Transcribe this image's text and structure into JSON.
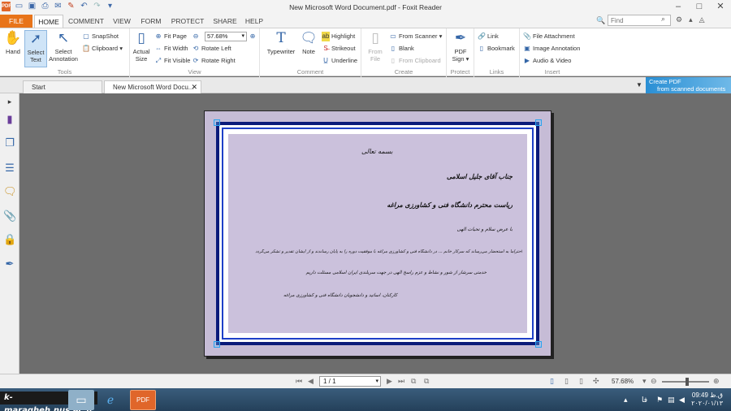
{
  "window": {
    "title": "New Microsoft Word Document.pdf - Foxit Reader",
    "logo": "PDF",
    "controls": [
      "–",
      "□",
      "✕"
    ]
  },
  "ribbon_tabs": [
    {
      "label": "FILE"
    },
    {
      "label": "HOME"
    },
    {
      "label": "COMMENT"
    },
    {
      "label": "VIEW"
    },
    {
      "label": "FORM"
    },
    {
      "label": "PROTECT"
    },
    {
      "label": "SHARE"
    },
    {
      "label": "HELP"
    }
  ],
  "search": {
    "placeholder": "Find"
  },
  "groups": {
    "tools": {
      "label": "Tools",
      "hand": "Hand",
      "select_text": "Select\nText",
      "select_annotation": "Select\nAnnotation",
      "snapshot": "SnapShot",
      "clipboard": "Clipboard"
    },
    "view": {
      "label": "View",
      "actual_size": "Actual\nSize",
      "fit_page": "Fit Page",
      "fit_width": "Fit Width",
      "fit_visible": "Fit Visible",
      "zoom_value": "57.68%",
      "rotate_left": "Rotate Left",
      "rotate_right": "Rotate Right"
    },
    "comment": {
      "label": "Comment",
      "typewriter": "Typewriter",
      "note": "Note",
      "highlight": "Highlight",
      "strikeout": "Strikeout",
      "underline": "Underline"
    },
    "create": {
      "label": "Create",
      "from_file": "From\nFile",
      "from_scanner": "From Scanner",
      "blank": "Blank",
      "from_clipboard": "From Clipboard"
    },
    "protect": {
      "label": "Protect",
      "pdf_sign": "PDF\nSign"
    },
    "links": {
      "label": "Links",
      "link": "Link",
      "bookmark": "Bookmark"
    },
    "insert": {
      "label": "Insert",
      "file_attachment": "File Attachment",
      "image_annotation": "Image Annotation",
      "audio_video": "Audio & Video"
    }
  },
  "doc_tabs": [
    {
      "label": "Start"
    },
    {
      "label": "New Microsoft Word Docu..."
    }
  ],
  "promo": {
    "line1": "Create PDF",
    "line2": "from scanned documents"
  },
  "document": {
    "lines": [
      "بسمه تعالی",
      "جناب آقای جلیل اسلامی",
      "ریاست محترم دانشگاه فنی و کشاورزی مراغه",
      "با عرض سلام و تحیات الهی",
      "احتراماً به استحضار می‌رساند که سرکار خانم ... در دانشگاه فنی و کشاورزی مراغه با موفقیت دوره را به پایان رساندند و از ایشان تقدیر و تشکر می‌گردد",
      "خدمتی سرشار از شور و نشاط و عزم راسخ الهی در جهت سربلندی ایران اسلامی مسئلت داریم",
      "کارکنان، اساتید و دانشجویان دانشگاه فنی و کشاورزی مراغه"
    ]
  },
  "status": {
    "page_value": "1 / 1",
    "zoom": "57.68%"
  },
  "taskbar": {
    "watermark": "k-maragheh.nus.ac.ir",
    "time": "09:49",
    "date": "۲۰۲۰/۰۱/۱۳",
    "lang": "فا",
    "period": "ق.ظ"
  }
}
